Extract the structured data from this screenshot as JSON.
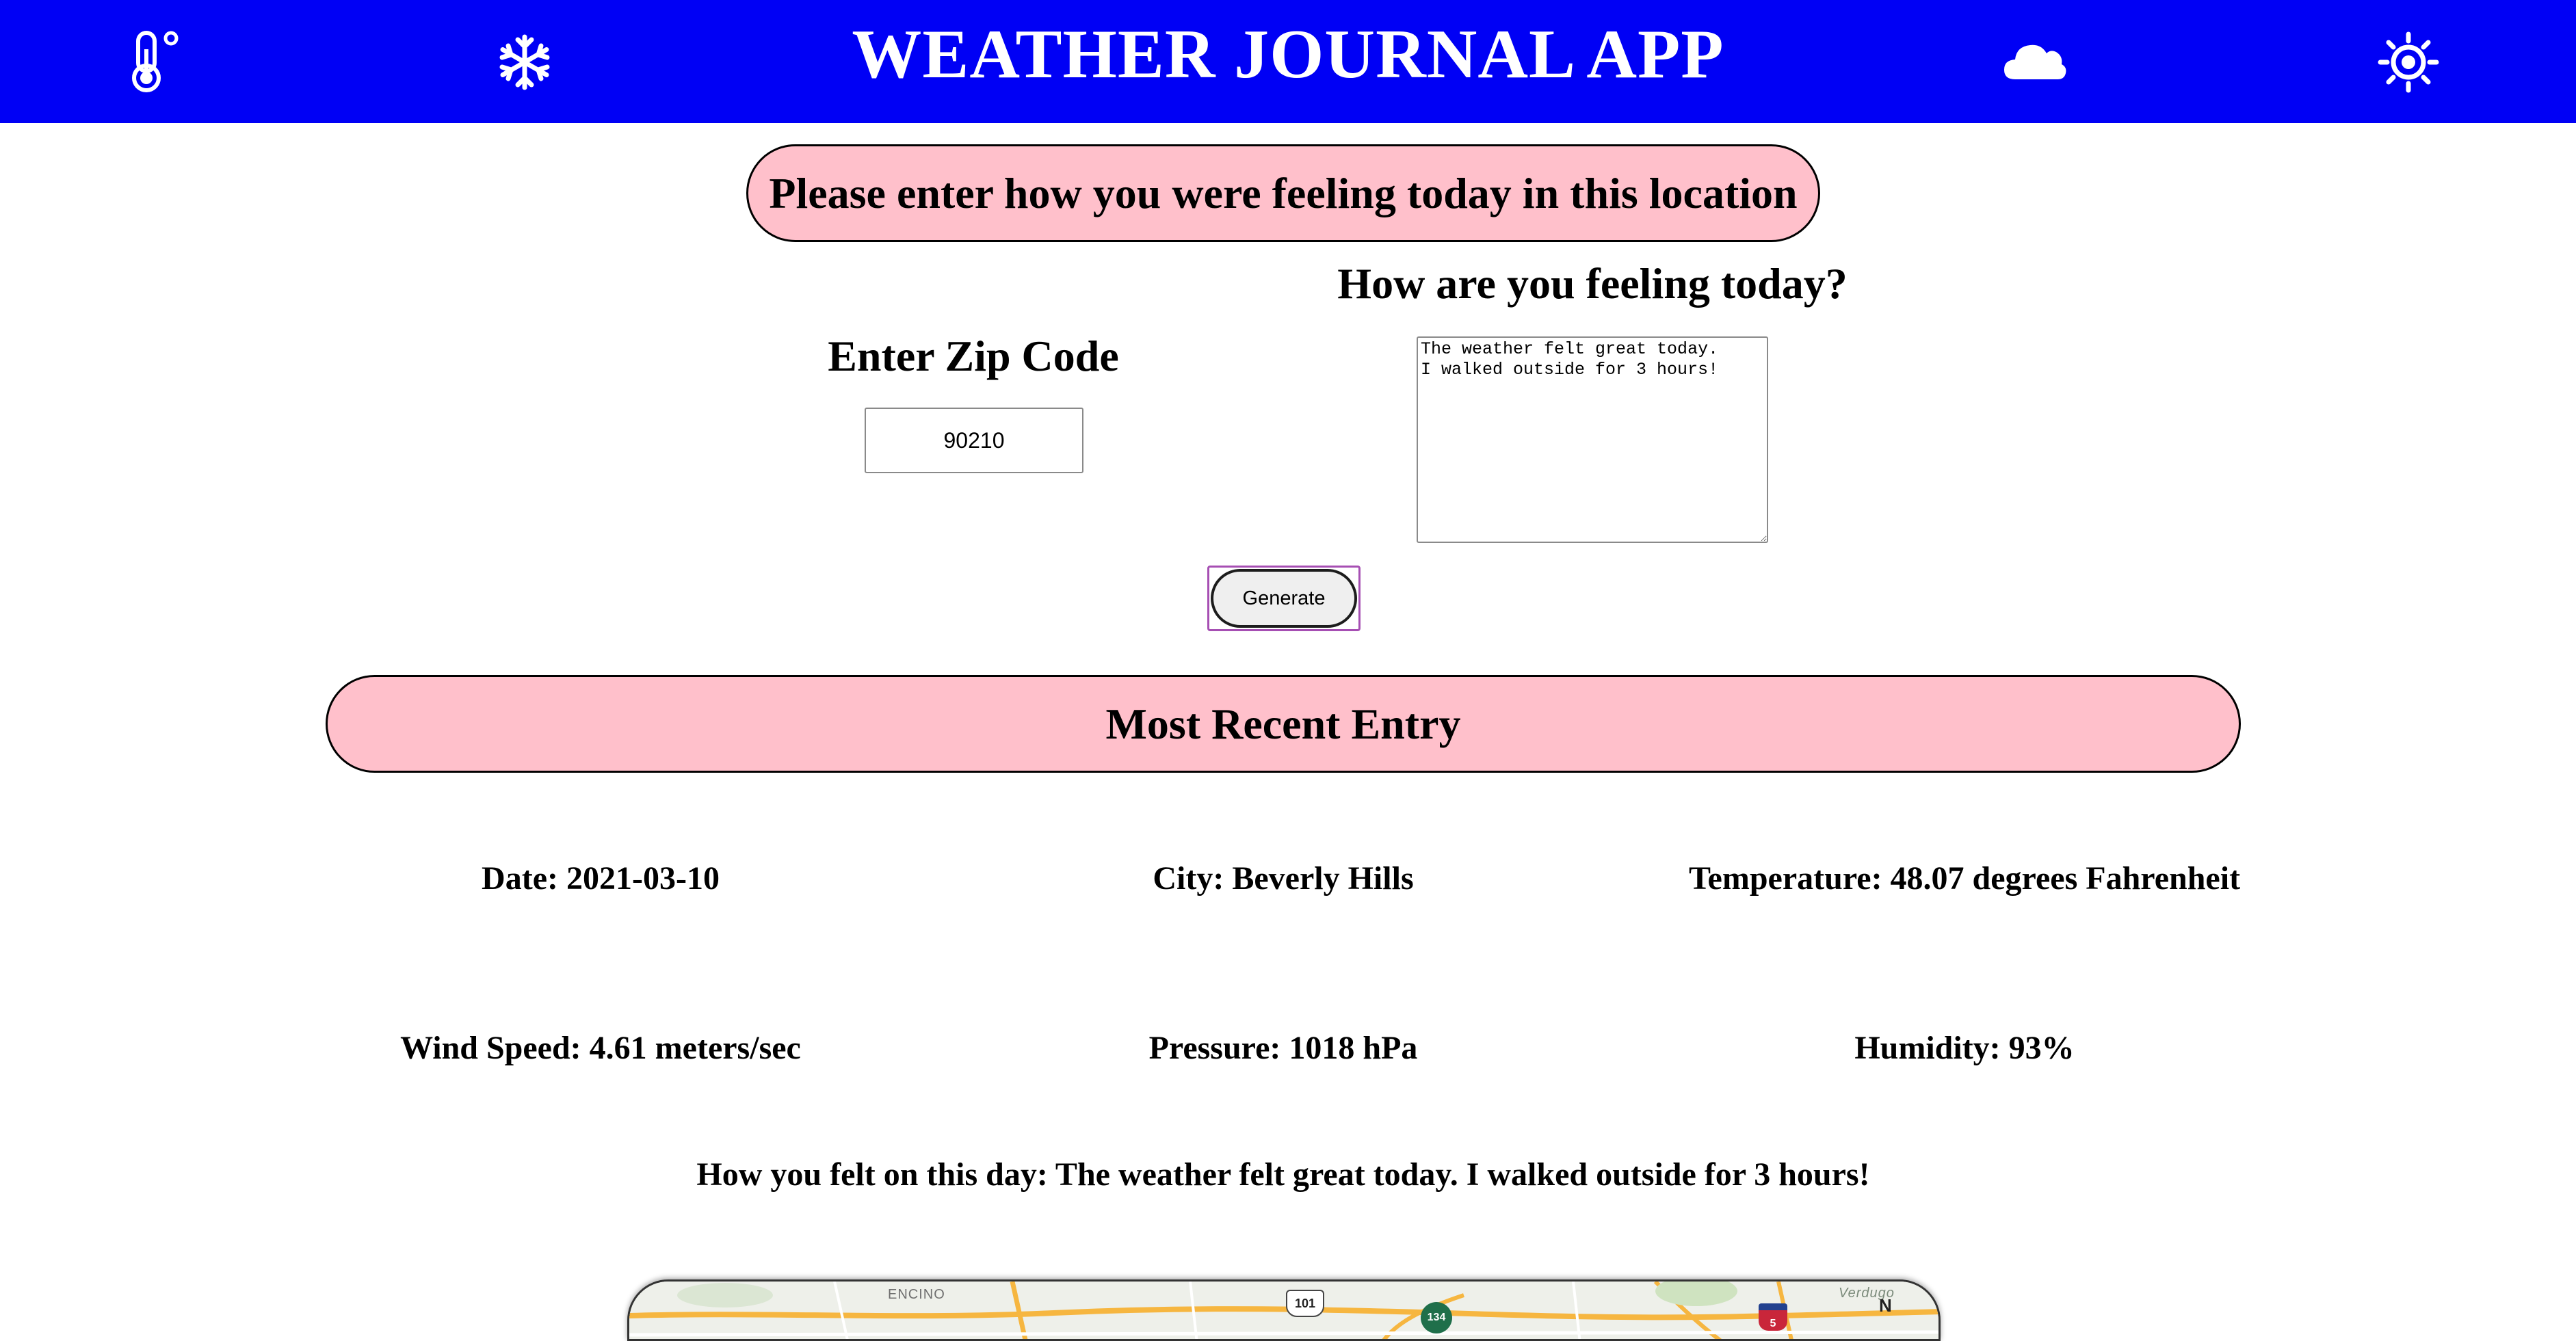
{
  "header": {
    "title": "WEATHER JOURNAL APP",
    "icons": [
      "thermometer-icon",
      "snowflake-icon",
      "cloud-icon",
      "sun-icon"
    ],
    "background_color": "#0000f5",
    "text_color": "#ffffff"
  },
  "form": {
    "prompt": "Please enter how you were feeling today in this location",
    "zip_label": "Enter Zip Code",
    "zip_value": "90210",
    "feelings_label": "How are you feeling today?",
    "feelings_value": "The weather felt great today.\nI walked outside for 3 hours!",
    "generate_label": "Generate",
    "pill_color": "#ffc0cb"
  },
  "entry": {
    "heading": "Most Recent Entry",
    "date": "Date: 2021-03-10",
    "city": "City: Beverly Hills",
    "temperature": "Temperature: 48.07 degrees Fahrenheit",
    "wind_speed": "Wind Speed: 4.61 meters/sec",
    "pressure": "Pressure: 1018 hPa",
    "humidity": "Humidity: 93%",
    "content": "How you felt on this day: The weather felt great today. I walked outside for 3 hours!"
  },
  "map": {
    "label_encino": "ENCINO",
    "label_verdugo": "Verdugo",
    "shield_101": "101",
    "shield_134": "134",
    "shield_5": "5",
    "compass": "N"
  }
}
